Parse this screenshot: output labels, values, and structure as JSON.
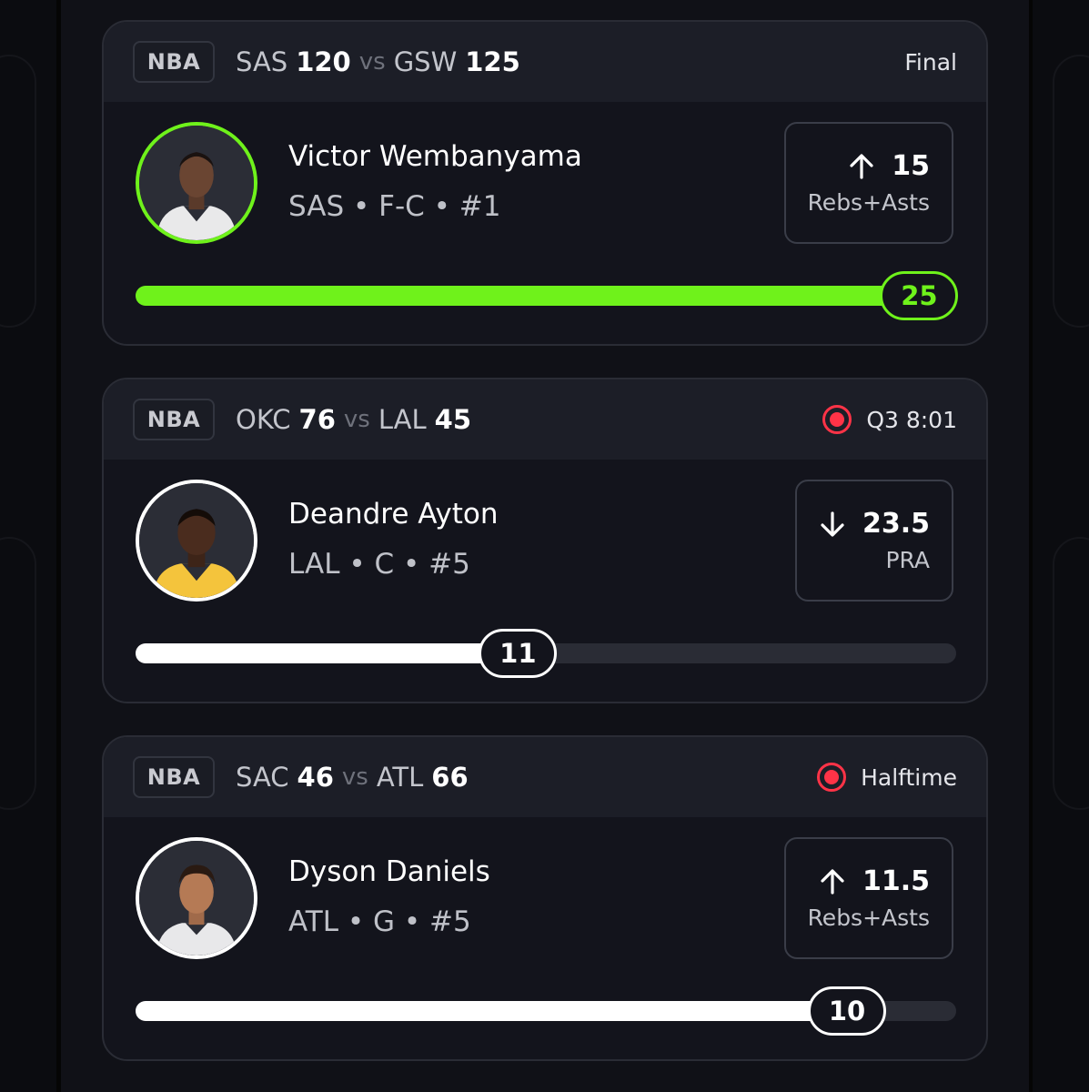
{
  "accent_color": "#6ff21b",
  "live_color": "#ff3347",
  "cards": [
    {
      "league": "NBA",
      "team1": "SAS",
      "score1": "120",
      "vs": "vs",
      "team2": "GSW",
      "score2": "125",
      "status": "Final",
      "live": false,
      "player_name": "Victor Wembanyama",
      "player_meta": "SAS • F-C • #1",
      "prop_direction": "up",
      "prop_value": "15",
      "prop_label": "Rebs+Asts",
      "progress_value": "25",
      "progress_fraction": 0.955,
      "hit": true
    },
    {
      "league": "NBA",
      "team1": "OKC",
      "score1": "76",
      "vs": "vs",
      "team2": "LAL",
      "score2": "45",
      "status": "Q3 8:01",
      "live": true,
      "player_name": "Deandre Ayton",
      "player_meta": "LAL • C • #5",
      "prop_direction": "down",
      "prop_value": "23.5",
      "prop_label": "PRA",
      "progress_value": "11",
      "progress_fraction": 0.466,
      "hit": false
    },
    {
      "league": "NBA",
      "team1": "SAC",
      "score1": "46",
      "vs": "vs",
      "team2": "ATL",
      "score2": "66",
      "status": "Halftime",
      "live": true,
      "player_name": "Dyson Daniels",
      "player_meta": "ATL • G • #5",
      "prop_direction": "up",
      "prop_value": "11.5",
      "prop_label": "Rebs+Asts",
      "progress_value": "10",
      "progress_fraction": 0.867,
      "hit": false
    }
  ]
}
